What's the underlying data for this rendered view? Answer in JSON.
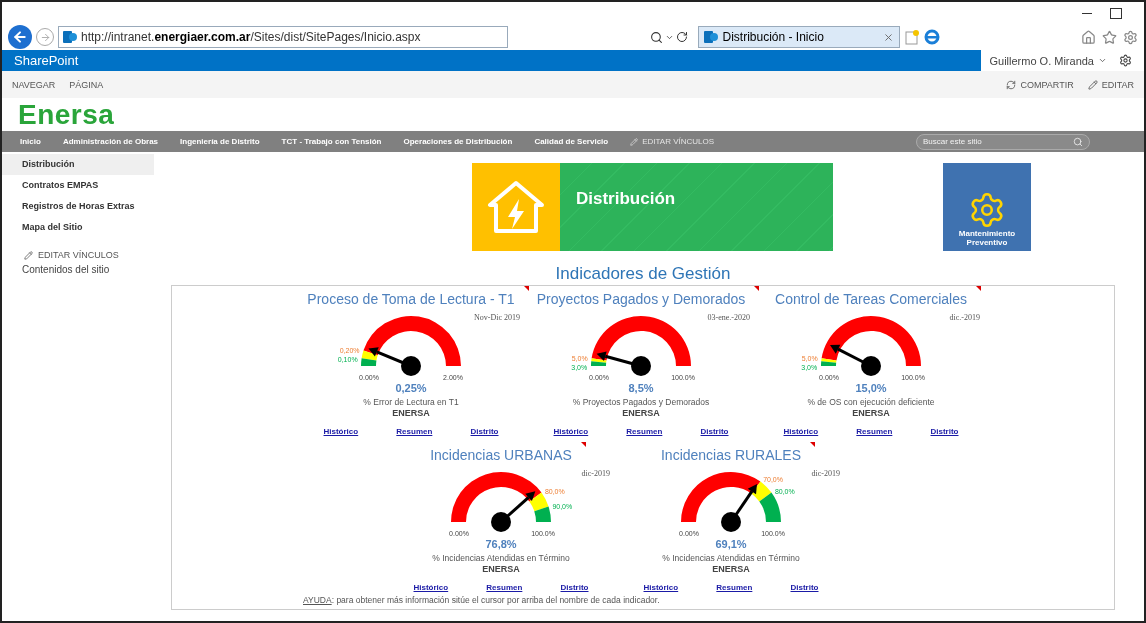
{
  "browser": {
    "url": "http://intranet.**energiaer.com.ar**/Sites/dist/SitePages/Inicio.aspx",
    "tab_title": "Distribución - Inicio"
  },
  "suite_bar": {
    "brand": "SharePoint",
    "user": "Guillermo O. Miranda"
  },
  "ribbon": {
    "tabs": [
      "NAVEGAR",
      "PÁGINA"
    ],
    "share": "COMPARTIR",
    "edit": "EDITAR"
  },
  "logo": "Enersa",
  "top_nav": {
    "items": [
      "Inicio",
      "Administración de Obras",
      "Ingeniería de Distrito",
      "TCT - Trabajo con Tensión",
      "Operaciones de Distribución",
      "Calidad de Servicio"
    ],
    "edit_links": "EDITAR VÍNCULOS",
    "search_placeholder": "Buscar este sitio"
  },
  "sidebar": {
    "items": [
      {
        "label": "Distribución",
        "selected": true
      },
      {
        "label": "Contratos EMPAS",
        "selected": false
      },
      {
        "label": "Registros de Horas Extras",
        "selected": false
      },
      {
        "label": "Mapa del Sitio",
        "selected": false
      }
    ],
    "edit_links": "EDITAR VÍNCULOS",
    "site_contents": "Contenidos del sitio"
  },
  "banner": {
    "title": "Distribución",
    "tile": "Mantenimiento Preventivo"
  },
  "heading": "Indicadores de Gestión",
  "rows": [
    {
      "gauges": [
        {
          "kind": "low_good",
          "title": "Proceso de Toma de Lectura - T1",
          "date": "Nov-Dic 2019",
          "min_label": "0,00%",
          "max_label": "2,00%",
          "bands": [
            {
              "color": "#ff0000"
            },
            {
              "color": "#ffff00",
              "label": "0,20%"
            },
            {
              "color": "#00b050",
              "label": "0,10%"
            }
          ],
          "value": "0,25%",
          "caption": "% Error de Lectura en T1",
          "entity": "ENERSA",
          "links": [
            "Histórico",
            "Resumen",
            "Distrito"
          ]
        },
        {
          "kind": "low_good",
          "title": "Proyectos Pagados y Demorados",
          "date": "03-ene.-2020",
          "min_label": "0,00%",
          "max_label": "100,0%",
          "bands": [
            {
              "color": "#ff0000"
            },
            {
              "color": "#ffff00",
              "label": "5,0%"
            },
            {
              "color": "#00b050",
              "label": "3,0%"
            }
          ],
          "value": "8,5%",
          "caption": "% Proyectos Pagados y Demorados",
          "entity": "ENERSA",
          "links": [
            "Histórico",
            "Resumen",
            "Distrito"
          ]
        },
        {
          "kind": "low_good",
          "title": "Control de Tareas Comerciales",
          "date": "dic.-2019",
          "min_label": "0,00%",
          "max_label": "100,0%",
          "bands": [
            {
              "color": "#ff0000"
            },
            {
              "color": "#ffff00",
              "label": "5,0%"
            },
            {
              "color": "#00b050",
              "label": "3,0%"
            }
          ],
          "value": "15,0%",
          "caption": "% de OS con ejecución deficiente",
          "entity": "ENERSA",
          "links": [
            "Histórico",
            "Resumen",
            "Distrito"
          ]
        }
      ]
    },
    {
      "gauges": [
        {
          "kind": "high_good",
          "title": "Incidencias URBANAS",
          "date": "dic-2019",
          "min_label": "0,00%",
          "max_label": "100,0%",
          "bands": [
            {
              "color": "#ff0000",
              "label": "80,0%"
            },
            {
              "color": "#ffff00",
              "label": "90,0%"
            },
            {
              "color": "#00b050"
            }
          ],
          "value": "76,8%",
          "caption": "% Incidencias Atendidas en Término",
          "entity": "ENERSA",
          "links": [
            "Histórico",
            "Resumen",
            "Distrito"
          ]
        },
        {
          "kind": "high_good",
          "title": "Incidencias RURALES",
          "date": "dic-2019",
          "min_label": "0,00%",
          "max_label": "100,0%",
          "bands": [
            {
              "color": "#ff0000",
              "label": "70,0%"
            },
            {
              "color": "#ffff00",
              "label": "80,0%"
            },
            {
              "color": "#00b050"
            }
          ],
          "value": "69,1%",
          "caption": "% Incidencias Atendidas en Término",
          "entity": "ENERSA",
          "links": [
            "Histórico",
            "Resumen",
            "Distrito"
          ]
        }
      ]
    }
  ],
  "help": {
    "label": "AYUDA",
    "text": ": para obtener más información sitúe el cursor por arriba del nombre de cada indicador."
  }
}
